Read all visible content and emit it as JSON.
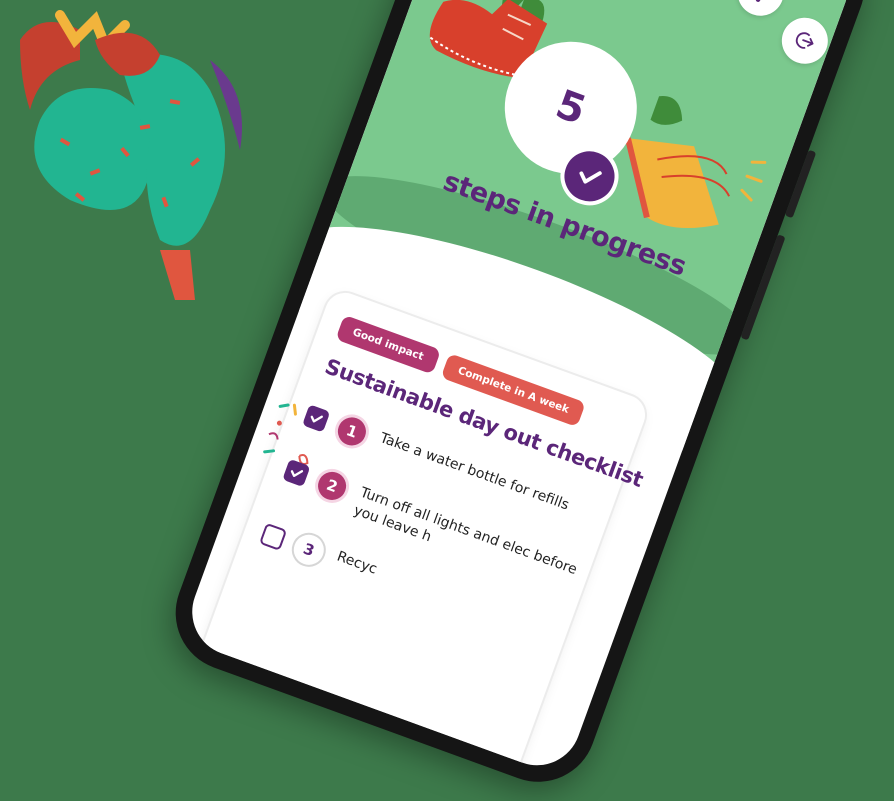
{
  "colors": {
    "background": "#3d7a4b",
    "hero": "#7bc98e",
    "brand_purple": "#5b2679",
    "tag_pink": "#b0376f",
    "tag_red": "#e05a51",
    "step_active": "#b0376f"
  },
  "header": {
    "bell_icon": "bell-icon",
    "logout_icon": "logout-icon"
  },
  "hero": {
    "count": "5",
    "title": "steps in progress"
  },
  "card": {
    "tags": [
      {
        "label": "Good impact"
      },
      {
        "label": "Complete in A week"
      }
    ],
    "title": "Sustainable day out checklist",
    "steps": [
      {
        "number": "1",
        "text": "Take a water bottle for refills",
        "checked": true
      },
      {
        "number": "2",
        "text": "Turn off all lights and elec before you leave h",
        "checked": true
      },
      {
        "number": "3",
        "text": "Recyc",
        "checked": false
      }
    ]
  }
}
